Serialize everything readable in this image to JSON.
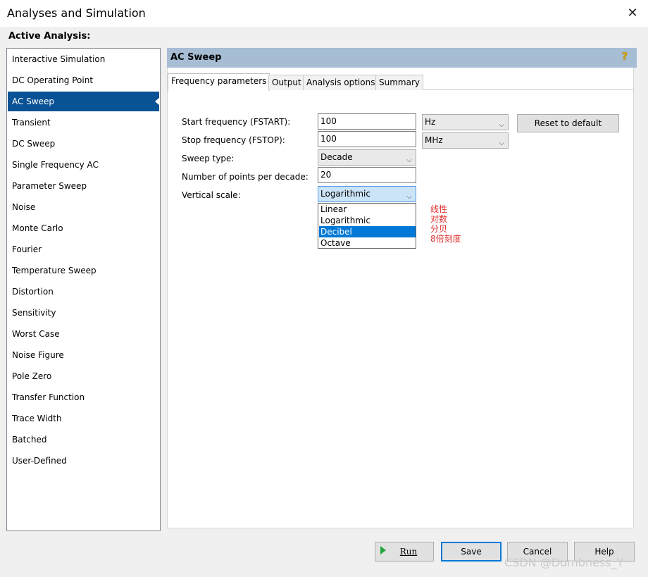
{
  "window": {
    "title": "Analyses and Simulation",
    "close_glyph": "✕"
  },
  "active_analysis_label": "Active Analysis:",
  "analysis_list": {
    "selected": "AC Sweep",
    "items": [
      "Interactive Simulation",
      "DC Operating Point",
      "AC Sweep",
      "Transient",
      "DC Sweep",
      "Single Frequency AC",
      "Parameter Sweep",
      "Noise",
      "Monte Carlo",
      "Fourier",
      "Temperature Sweep",
      "Distortion",
      "Sensitivity",
      "Worst Case",
      "Noise Figure",
      "Pole Zero",
      "Transfer Function",
      "Trace Width",
      "Batched",
      "User-Defined"
    ]
  },
  "panel": {
    "title": "AC Sweep",
    "help_glyph": "?"
  },
  "tabs": [
    "Frequency parameters",
    "Output",
    "Analysis options",
    "Summary"
  ],
  "form": {
    "start_frequency_label": "Start frequency (FSTART):",
    "start_frequency_value": "100",
    "start_frequency_unit": "Hz",
    "stop_frequency_label": "Stop frequency (FSTOP):",
    "stop_frequency_value": "100",
    "stop_frequency_unit": "MHz",
    "sweep_type_label": "Sweep type:",
    "sweep_type_value": "Decade",
    "points_label": "Number of points per decade:",
    "points_value": "20",
    "vertical_scale_label": "Vertical scale:",
    "vertical_scale_value": "Logarithmic",
    "reset_button": "Reset to default",
    "dropdown_options": [
      "Linear",
      "Logarithmic",
      "Decibel",
      "Octave"
    ],
    "dropdown_highlighted": "Decibel"
  },
  "annotations": [
    "线性",
    "对数",
    "分贝",
    "8倍刻度"
  ],
  "buttons": {
    "run": "Run",
    "save": "Save",
    "cancel": "Cancel",
    "help": "Help"
  },
  "watermark": "CSDN @Dumbness_Y",
  "colors": {
    "selection": "#0a5296",
    "panel_header": "#a6bdd4",
    "annotation": "#e03030",
    "dropdown_highlight": "#0078d7",
    "run_icon": "#22a83a"
  }
}
